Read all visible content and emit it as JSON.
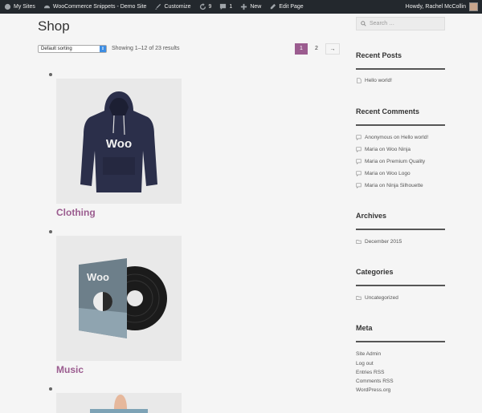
{
  "adminbar": {
    "my_sites": "My Sites",
    "site_name": "WooCommerce Snippets - Demo Site",
    "customize": "Customize",
    "updates_count": "9",
    "comments_count": "1",
    "new": "New",
    "edit_page": "Edit Page",
    "howdy": "Howdy, Rachel McCollin"
  },
  "main": {
    "title": "Shop",
    "sorting": "Default sorting",
    "result_count": "Showing 1–12 of 23 results",
    "pagination": [
      "1",
      "2",
      "→"
    ],
    "products": [
      {
        "title": "Clothing"
      },
      {
        "title": "Music"
      }
    ]
  },
  "sidebar": {
    "search_placeholder": "Search …",
    "recent_posts": {
      "title": "Recent Posts",
      "items": [
        "Hello world!"
      ]
    },
    "recent_comments": {
      "title": "Recent Comments",
      "items": [
        "Anonymous on Hello world!",
        "Maria on Woo Ninja",
        "Maria on Premium Quality",
        "Maria on Woo Logo",
        "Maria on Ninja Silhouette"
      ]
    },
    "archives": {
      "title": "Archives",
      "items": [
        "December 2015"
      ]
    },
    "categories": {
      "title": "Categories",
      "items": [
        "Uncategorized"
      ]
    },
    "meta": {
      "title": "Meta",
      "items": [
        "Site Admin",
        "Log out",
        "Entries RSS",
        "Comments RSS",
        "WordPress.org"
      ]
    }
  },
  "colors": {
    "accent": "#9b5c8f",
    "adminbar": "#23282d"
  }
}
